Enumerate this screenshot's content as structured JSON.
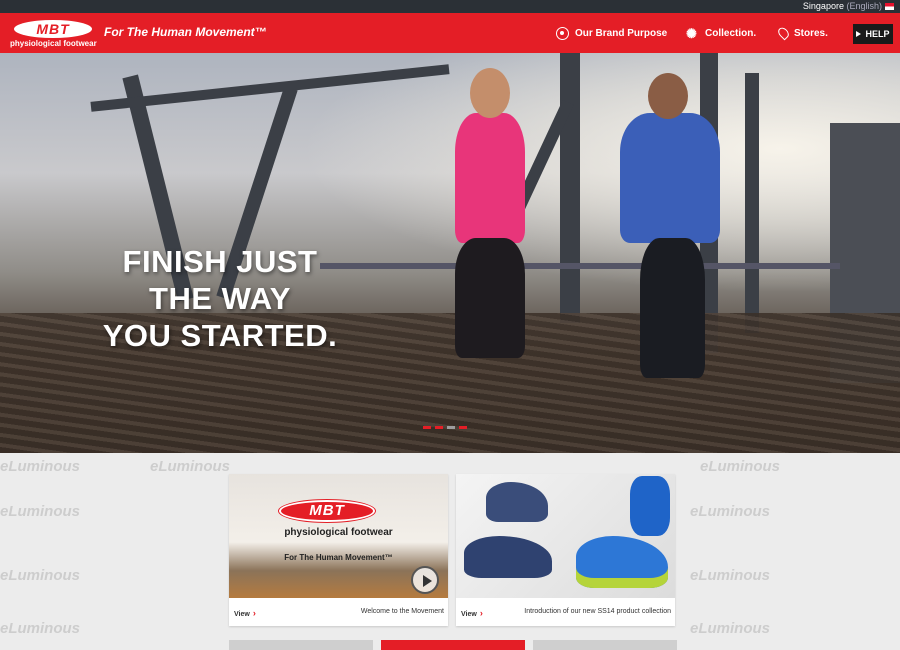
{
  "topbar": {
    "region": "Singapore",
    "language": "(English)"
  },
  "header": {
    "logo_mark": "MBT",
    "logo_sub": "physiological footwear",
    "tagline": "For The Human Movement™",
    "nav": [
      {
        "label": "Our Brand Purpose",
        "icon": "target-icon"
      },
      {
        "label": "Collection.",
        "icon": "sunburst-icon"
      },
      {
        "label": "Stores.",
        "icon": "map-pin-icon"
      }
    ],
    "help_label": "HELP"
  },
  "hero": {
    "headline_line1": "FINISH JUST",
    "headline_line2": "THE WAY",
    "headline_line3": "YOU STARTED.",
    "slides": 4,
    "active_slide": 3
  },
  "watermark": "eLuminous",
  "cards": [
    {
      "view_label": "View",
      "caption": "Welcome to the Movement",
      "thumb_mark": "MBT",
      "thumb_sub": "physiological footwear",
      "thumb_tag": "For The Human Movement™"
    },
    {
      "view_label": "View",
      "caption": "Introduction of our new SS14 product collection"
    }
  ],
  "colors": {
    "brand_red": "#e41e26",
    "topbar": "#2b3036",
    "help_bg": "#1a1a1a"
  }
}
